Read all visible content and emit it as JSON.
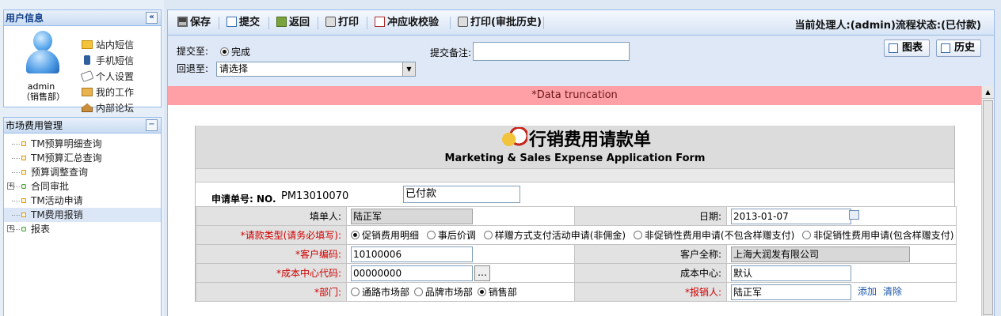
{
  "sidebar": {
    "user_panel_title": "用户信息",
    "collapse_glyph": "«",
    "user_name": "admin（销售部）",
    "links": [
      {
        "label": "站内短信",
        "icon": "mail-icon"
      },
      {
        "label": "手机短信",
        "icon": "mobile-phone-icon"
      },
      {
        "label": "个人设置",
        "icon": "settings-icon"
      },
      {
        "label": "我的工作",
        "icon": "folder-icon"
      },
      {
        "label": "内部论坛",
        "icon": "forum-house-icon"
      }
    ],
    "nav_title": "市场费用管理",
    "nav_collapse_glyph": "−",
    "nav_items": [
      {
        "label": "TM预算明细查询",
        "expandable": false
      },
      {
        "label": "TM预算汇总查询",
        "expandable": false
      },
      {
        "label": "预算调整查询",
        "expandable": false
      },
      {
        "label": "合同审批",
        "expandable": true
      },
      {
        "label": "TM活动申请",
        "expandable": false
      },
      {
        "label": "TM费用报销",
        "expandable": false,
        "selected": true
      },
      {
        "label": "报表",
        "expandable": true
      }
    ]
  },
  "toolbar": {
    "save": "保存",
    "submit": "提交",
    "back": "返回",
    "print": "打印",
    "offset_check": "冲应收校验",
    "print_history": "打印(审批历史)",
    "handler_status": "当前处理人:(admin)流程状态:(已付款)"
  },
  "submit_bar": {
    "submit_to_label": "提交至:",
    "submit_to_option": "完成",
    "return_to_label": "回退至:",
    "return_to_value": "请选择",
    "note_label": "提交备注:",
    "note_value": "",
    "chart_button": "图表",
    "history_button": "历史"
  },
  "alert": "*Data truncation",
  "form": {
    "title_cn": "行销费用请款单",
    "title_en": "Marketing & Sales Expense Application Form",
    "no_label": "申请单号: NO.",
    "no_value": "PM13010070",
    "status_value": "已付款",
    "filler_label": "填单人:",
    "filler_value": "陆正军",
    "date_label": "日期:",
    "date_value": "2013-01-07",
    "type_label": "*请款类型(请务必填写):",
    "type_options": [
      {
        "label": "促销费用明细",
        "checked": true
      },
      {
        "label": "事后价调",
        "checked": false
      },
      {
        "label": "样赠方式支付活动申请(非佣金)",
        "checked": false
      },
      {
        "label": "非促销性费用申请(不包含样赠支付)",
        "checked": false
      },
      {
        "label": "非促销性费用申请(包含样赠支付)",
        "checked": false
      }
    ],
    "customer_code_label": "*客户编码:",
    "customer_code_value": "10100006",
    "customer_name_label": "客户全称:",
    "customer_name_value": "上海大润发有限公司",
    "cost_center_code_label": "*成本中心代码:",
    "cost_center_code_value": "00000000",
    "cost_center_label": "成本中心:",
    "cost_center_value": "默认",
    "dept_label": "*部门:",
    "dept_options": [
      {
        "label": "通路市场部",
        "checked": false
      },
      {
        "label": "品牌市场部",
        "checked": false
      },
      {
        "label": "销售部",
        "checked": true
      }
    ],
    "claimant_label": "*报销人:",
    "claimant_value": "陆正军",
    "add_link": "添加",
    "clear_link": "清除"
  }
}
